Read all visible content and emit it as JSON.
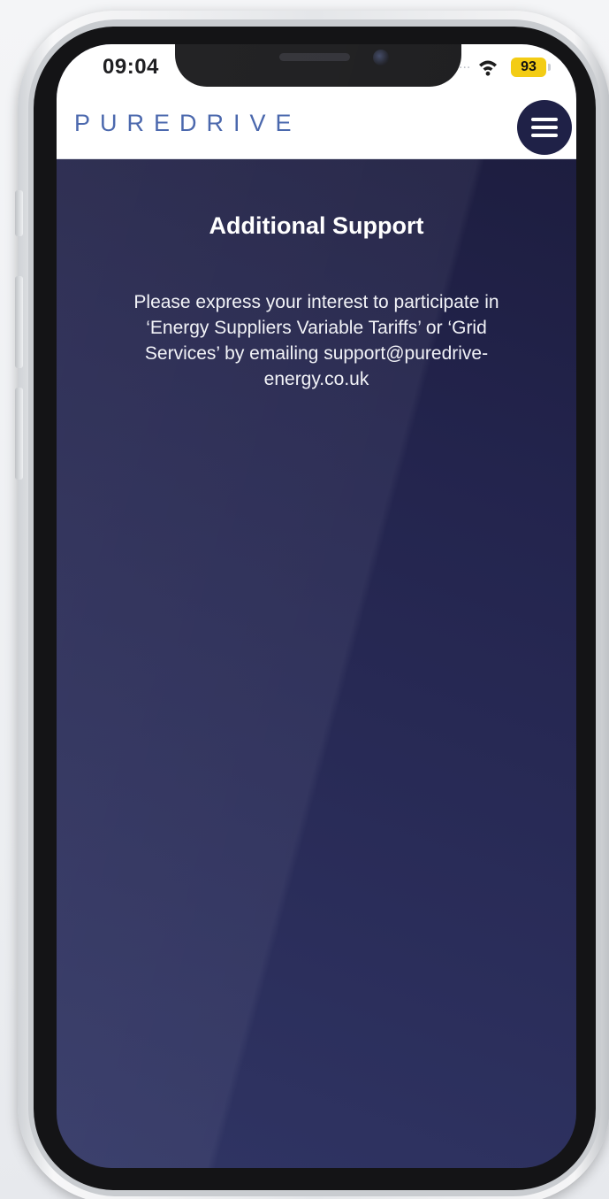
{
  "status_bar": {
    "time": "09:04",
    "signal_indicator": "...",
    "wifi_icon": "wifi-icon",
    "battery_level": "93",
    "battery_color": "#f3cc14"
  },
  "header": {
    "logo_text": "PUREDRIVE",
    "logo_color": "#3f5ea8",
    "menu_icon": "hamburger-menu-icon"
  },
  "main": {
    "title": "Additional Support",
    "body_text": "Please express your interest to participate in ‘Energy Suppliers Variable Tariffs’ or ‘Grid Services’ by emailing support@puredrive-energy.co.uk"
  },
  "colors": {
    "background_top": "#1b1b3b",
    "background_bottom": "#303564",
    "menu_button": "#1f2147"
  }
}
